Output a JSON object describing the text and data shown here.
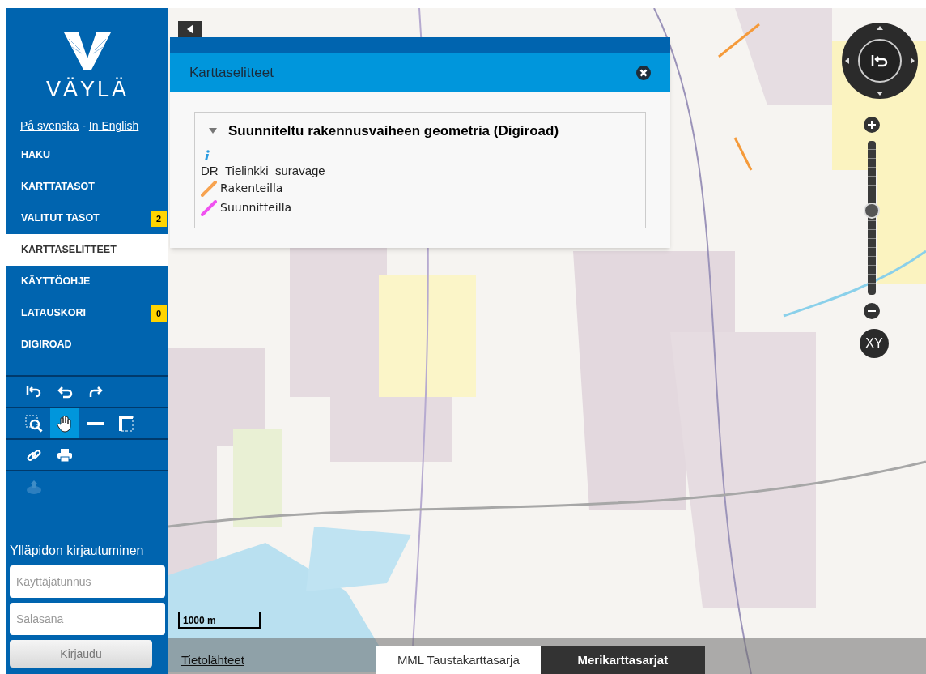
{
  "sidebar": {
    "logo_text": "VÄYLÄ",
    "language_links": [
      {
        "label": "På svenska"
      },
      {
        "label": "In English"
      }
    ],
    "separator": "-",
    "menu": [
      {
        "label": "HAKU",
        "selected": false
      },
      {
        "label": "KARTTATASOT",
        "selected": false
      },
      {
        "label": "VALITUT TASOT",
        "selected": false,
        "badge": "2"
      },
      {
        "label": "KARTTASELITTEET",
        "selected": true
      },
      {
        "label": "KÄYTTÖOHJE",
        "selected": false
      },
      {
        "label": "LATAUSKORI",
        "selected": false,
        "badge": "0"
      },
      {
        "label": "DIGIROAD",
        "selected": false
      }
    ],
    "tool_rows": [
      [
        {
          "kind": "reset",
          "selected": false
        },
        {
          "kind": "undo",
          "selected": false
        },
        {
          "kind": "redo",
          "selected": false
        }
      ],
      [
        {
          "kind": "zoombox",
          "selected": false
        },
        {
          "kind": "pan",
          "selected": true
        },
        {
          "kind": "measure-line",
          "selected": false
        },
        {
          "kind": "measure-area",
          "selected": false
        }
      ],
      [
        {
          "kind": "link",
          "selected": false
        },
        {
          "kind": "print",
          "selected": false
        }
      ],
      [
        {
          "kind": "upload",
          "selected": false,
          "disabled": true
        }
      ]
    ],
    "login": {
      "title": "Ylläpidon kirjautuminen",
      "username": {
        "placeholder": "Käyttäjätunnus"
      },
      "password": {
        "placeholder": "Salasana"
      },
      "button": "Kirjaudu"
    }
  },
  "legend_panel": {
    "title": "Karttaselitteet",
    "group": {
      "title": "Suunniteltu rakennusvaiheen geometria (Digiroad)",
      "expanded": true,
      "layer": "DR_Tielinkki_suravage",
      "items": [
        {
          "label": "Rakenteilla",
          "color": "#f7a350"
        },
        {
          "label": "Suunnitteilla",
          "color": "#f052f0"
        }
      ]
    }
  },
  "map": {
    "zoom": {
      "level": 0.55
    },
    "scale": "1000 m",
    "data_sources": "Tietolähteet",
    "background_maps": [
      {
        "label": "MML Taustakarttasarja",
        "selected": false
      },
      {
        "label": "Merikarttasarjat",
        "selected": true
      }
    ],
    "coordinates_button": "XY"
  }
}
